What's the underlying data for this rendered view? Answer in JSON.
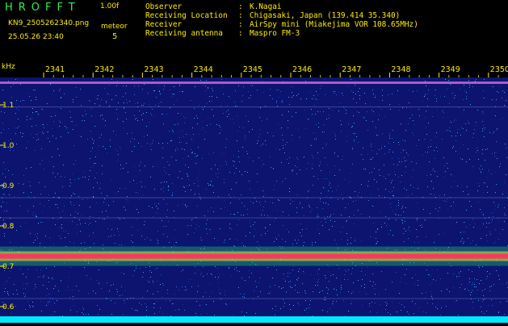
{
  "header": {
    "app_title": "HROFFT",
    "version": "1.00f",
    "filename": "KN9_2505262340.png",
    "datetime": "25.05.26 23:40",
    "mode_label": "meteor",
    "mode_value": "5",
    "info": [
      {
        "key": "Observer",
        "value": "K.Nagai"
      },
      {
        "key": "Receiving Location",
        "value": "Chigasaki, Japan (139.414 35.340)"
      },
      {
        "key": "Receiver",
        "value": "AirSpy mini (Miakejima VOR 108.65MHz)"
      },
      {
        "key": "Receiving antenna",
        "value": "Maspro FM-3"
      }
    ]
  },
  "colors": {
    "text": "#ffee00",
    "title": "#33ee55",
    "background": "#0c1470",
    "bright_band": "#ff3060",
    "band_glow": "#22dd66",
    "bottom_strip": "#00e8ff"
  },
  "chart_data": {
    "type": "heatmap",
    "ylabel": "kHz",
    "yticks": [
      0.6,
      0.7,
      0.8,
      0.9,
      1.0,
      1.1
    ],
    "xticks": [
      "2341",
      "2342",
      "2343",
      "2344",
      "2345",
      "2346",
      "2347",
      "2348",
      "2349",
      "2350"
    ],
    "features": [
      {
        "name": "carrier band",
        "freq_khz": 0.725
      },
      {
        "name": "top carrier line",
        "freq_khz": 1.155
      },
      {
        "name": "faint line",
        "freq_khz": 1.095
      },
      {
        "name": "faint line",
        "freq_khz": 0.87
      },
      {
        "name": "faint line",
        "freq_khz": 0.82
      },
      {
        "name": "faint line",
        "freq_khz": 0.62
      }
    ]
  }
}
